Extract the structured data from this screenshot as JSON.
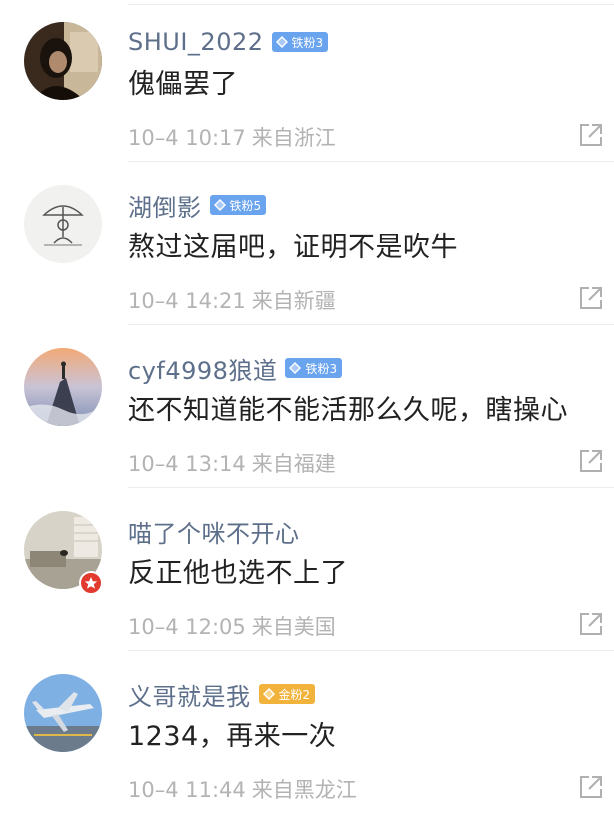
{
  "comments": [
    {
      "username": "SHUI_2022",
      "badge": {
        "label": "铁粉3",
        "color": "#6aa3ee",
        "icon": "diamond-icon"
      },
      "text": "傀儡罢了",
      "time": "10–4 10:17",
      "location": "来自浙江",
      "avatar": "dark-portrait-avatar"
    },
    {
      "username": "湖倒影",
      "badge": {
        "label": "铁粉5",
        "color": "#6aa3ee",
        "icon": "diamond-icon"
      },
      "text": "熬过这届吧，证明不是吹牛",
      "time": "10–4 14:21",
      "location": "来自新疆",
      "avatar": "sketch-umbrella-avatar"
    },
    {
      "username": "cyf4998狼道",
      "badge": {
        "label": "铁粉3",
        "color": "#6aa3ee",
        "icon": "diamond-icon"
      },
      "text": "还不知道能不能活那么久呢，瞎操心",
      "time": "10–4 13:14",
      "location": "来自福建",
      "avatar": "mountain-peak-avatar"
    },
    {
      "username": "喵了个咪不开心",
      "badge": null,
      "text": "反正他也选不上了",
      "time": "10–4 12:05",
      "location": "来自美国",
      "avatar": "room-interior-avatar",
      "vip_badge_icon": "star-icon"
    },
    {
      "username": "义哥就是我",
      "badge": {
        "label": "金粉2",
        "color": "#f2b33d",
        "icon": "diamond-icon"
      },
      "text": "1234，再来一次",
      "time": "10–4 11:44",
      "location": "来自黑龙江",
      "avatar": "fighter-jet-avatar"
    }
  ],
  "share_icon": "share-icon"
}
